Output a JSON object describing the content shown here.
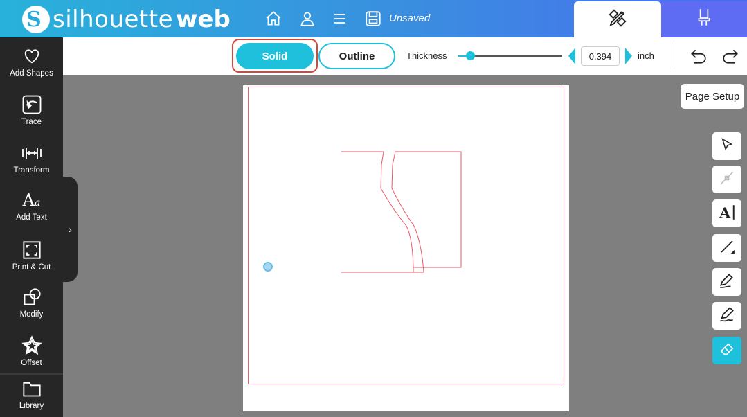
{
  "app": {
    "name_part1": "silhouette",
    "name_part2": "web",
    "logo_mark": "S",
    "save_status": "Unsaved"
  },
  "topbar_icons": [
    "home-icon",
    "user-icon",
    "menu-icon",
    "save-icon"
  ],
  "tabs": [
    {
      "name": "design",
      "icon": "pencil-ruler-icon",
      "active": true
    },
    {
      "name": "send",
      "icon": "blade-icon",
      "active": false
    }
  ],
  "sidebar": {
    "items": [
      {
        "label": "Add Shapes",
        "icon": "heart-icon"
      },
      {
        "label": "Trace",
        "icon": "trace-icon"
      },
      {
        "label": "Transform",
        "icon": "transform-icon"
      },
      {
        "label": "Add Text",
        "icon": "text-icon"
      },
      {
        "label": "Print & Cut",
        "icon": "print-cut-icon"
      },
      {
        "label": "Modify",
        "icon": "modify-icon"
      },
      {
        "label": "Offset",
        "icon": "star-icon"
      },
      {
        "label": "Library",
        "icon": "folder-icon"
      }
    ],
    "expand_glyph": "›"
  },
  "toolbar": {
    "solid_label": "Solid",
    "outline_label": "Outline",
    "thickness_label": "Thickness",
    "thickness_value": "0.394",
    "unit_label": "inch",
    "slider_level": 0.12
  },
  "right_panel": {
    "page_setup_label": "Page Setup",
    "tools": [
      "select-icon",
      "node-edit-icon",
      "text-tool-icon",
      "line-tool-icon",
      "pen-tool-icon",
      "freehand-tool-icon",
      "eraser-icon"
    ],
    "active_tool": "eraser-icon"
  },
  "colors": {
    "accent": "#1ec0dc",
    "cut_line": "#ea5a6a",
    "highlight": "#d8453a",
    "sidebar": "#262626",
    "canvas_bg": "#7f7f7f"
  }
}
